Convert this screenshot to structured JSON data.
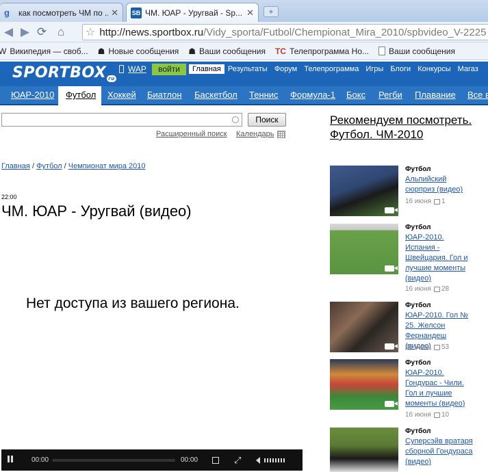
{
  "browser": {
    "tabs": [
      {
        "title": "как посмотреть ЧМ по ..."
      },
      {
        "title": "ЧМ. ЮАР - Уругвай - Sp..."
      }
    ],
    "url_host": "http://news.sportbox.ru",
    "url_path": "/Vidy_sporta/Futbol/Chempionat_Mira_2010/spbvideo_V-2225",
    "bookmarks": [
      {
        "label": "Википедия — своб...",
        "icon": "wikipedia-icon"
      },
      {
        "label": "Новые сообщения",
        "icon": "forum-icon"
      },
      {
        "label": "Ваши сообщения",
        "icon": "forum-icon"
      },
      {
        "label": "Телепрограмма Но...",
        "icon": "tc-icon"
      },
      {
        "label": "Ваши сообщения",
        "icon": "page-icon"
      }
    ]
  },
  "site": {
    "logo": "SPORTBOX",
    "logo_suffix": "ru",
    "wap": "WAP",
    "login": "войти",
    "top_nav": [
      "Главная",
      "Результаты",
      "Форум",
      "Телепрограмма",
      "Игры",
      "Блоги",
      "Конкурсы",
      "Магаз"
    ],
    "top_nav_active": "Главная",
    "sport_nav": [
      "ЮАР-2010",
      "Футбол",
      "Хоккей",
      "Биатлон",
      "Баскетбол",
      "Теннис",
      "Формула-1",
      "Бокс",
      "Регби",
      "Плавание",
      "Все в"
    ],
    "sport_nav_active": "Футбол"
  },
  "search": {
    "value": "",
    "button": "Поиск",
    "advanced": "Расширенный поиск",
    "calendar": "Календарь"
  },
  "breadcrumb": {
    "items": [
      "Главная",
      "Футбол",
      "Чемпионат мира 2010"
    ],
    "sep": "/"
  },
  "article": {
    "time": "22:00",
    "title": "ЧМ. ЮАР - Уругвай (видео)"
  },
  "video": {
    "message": "Нет доступа из вашего региона.",
    "current_time": "00:00",
    "duration": "00:00",
    "progress": 0
  },
  "sidebar": {
    "title": "Рекомендуем посмотреть. Футбол. ЧМ-2010",
    "items": [
      {
        "category": "Футбол",
        "title": "Альпийский сюрприз (видео)",
        "date": "16 июня",
        "comments": "1"
      },
      {
        "category": "Футбол",
        "title": "ЮАР-2010. Испания - Швейцария. Гол и лучшие моменты (видео)",
        "date": "16 июня",
        "comments": "28"
      },
      {
        "category": "Футбол",
        "title": "ЮАР-2010. Гол № 25. Желсон Фернандеш (видео)",
        "date": "16 июня",
        "comments": "53"
      },
      {
        "category": "Футбол",
        "title": "ЮАР-2010. Гондурас - Чили. Гол и лучшие моменты (видео)",
        "date": "16 июня",
        "comments": "10"
      },
      {
        "category": "Футбол",
        "title": "Суперсэйв вратаря сборной Гондураса (видео)",
        "date": "",
        "comments": ""
      }
    ]
  }
}
